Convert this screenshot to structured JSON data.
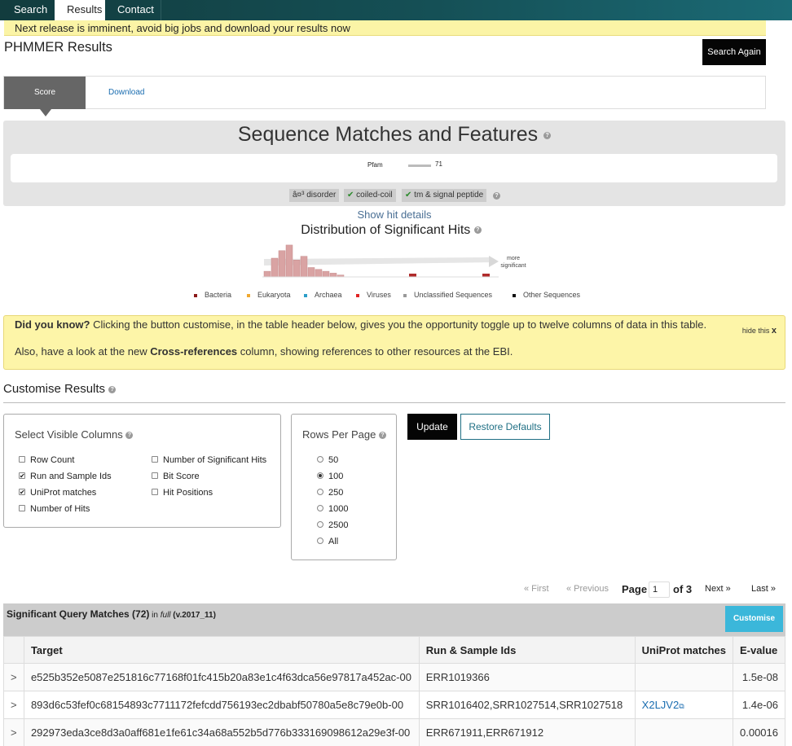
{
  "nav": {
    "tabs": [
      "Search",
      "Results",
      "Contact"
    ],
    "active": "Results"
  },
  "notice": "Next release is imminent, avoid big jobs and download your results now",
  "page_title": "PHMMER Results",
  "search_again": "Search Again",
  "result_tabs": {
    "score": "Score",
    "download": "Download"
  },
  "sequence_matches": {
    "title": "Sequence Matches and Features",
    "help": "?",
    "pfam_label": "Pfam",
    "pfam_value": "71",
    "features": [
      {
        "label": "â¤³ disorder",
        "checked": false
      },
      {
        "label": "coiled-coil",
        "checked": true
      },
      {
        "label": "tm & signal peptide",
        "checked": true
      }
    ],
    "check_glyph": "✔"
  },
  "show_hit_details": "Show hit details",
  "distribution": {
    "title": "Distribution of Significant Hits",
    "arrow_label": "more significant",
    "arrow_label_1": "more",
    "arrow_label_2": "significant"
  },
  "legend": [
    {
      "label": "Bacteria",
      "color": "#8b1a1a"
    },
    {
      "label": "Eukaryota",
      "color": "#f0a830"
    },
    {
      "label": "Archaea",
      "color": "#2c9ec8"
    },
    {
      "label": "Viruses",
      "color": "#e02424"
    },
    {
      "label": "Unclassified Sequences",
      "color": "#999999"
    },
    {
      "label": "Other Sequences",
      "color": "#111111"
    }
  ],
  "did_you_know": {
    "heading": "Did you know?",
    "line1": " Clicking the button customise, in the table header below, gives you the opportunity toggle up to twelve columns of data in this table.",
    "line2_pre": "Also, have a look at the new ",
    "line2_bold": "Cross-references",
    "line2_post": " column, showing references to other resources at the EBI.",
    "hide": "hide this",
    "hide_x": "x"
  },
  "customise": {
    "title": "Customise Results",
    "columns_title": "Select Visible Columns",
    "columns": [
      {
        "label": "Row Count",
        "checked": false
      },
      {
        "label": "Run and Sample Ids",
        "checked": true
      },
      {
        "label": "UniProt matches",
        "checked": true
      },
      {
        "label": "Number of Hits",
        "checked": false
      },
      {
        "label": "Number of Significant Hits",
        "checked": false
      },
      {
        "label": "Bit Score",
        "checked": false
      },
      {
        "label": "Hit Positions",
        "checked": false
      }
    ],
    "rows_title": "Rows Per Page",
    "rows": [
      {
        "label": "50",
        "selected": false
      },
      {
        "label": "100",
        "selected": true
      },
      {
        "label": "250",
        "selected": false
      },
      {
        "label": "1000",
        "selected": false
      },
      {
        "label": "2500",
        "selected": false
      },
      {
        "label": "All",
        "selected": false
      }
    ],
    "update": "Update",
    "restore": "Restore Defaults"
  },
  "pager": {
    "first": "« First",
    "previous": "« Previous",
    "page_label": "Page",
    "page_value": "1",
    "of": "of 3",
    "next": "Next »",
    "last": "Last »"
  },
  "table": {
    "title": "Significant Query Matches (72)",
    "in": " in ",
    "db": "full",
    "version": " (v.2017_11)",
    "customise": "Customise",
    "headers": [
      "",
      "Target",
      "Run & Sample Ids",
      "UniProt matches",
      "E-value"
    ],
    "rows": [
      {
        "expand": ">",
        "target": "e525b352e5087e251816c77168f01fc415b20a83e1c4f63dca56e97817a452ac-00",
        "runs": "ERR1019366",
        "uniprot": "",
        "evalue": "1.5e-08"
      },
      {
        "expand": ">",
        "target": "893d6c53fef0c68154893c7711172fefcdd756193ec2dbabf50780a5e8c79e0b-00",
        "runs": "SRR1016402,SRR1027514,SRR1027518",
        "uniprot": "X2LJV2",
        "evalue": "1.4e-06"
      },
      {
        "expand": ">",
        "target": "292973eda3ce8d3a0aff681e1fe61c34a68a552b5d776b333169098612a29e3f-00",
        "runs": "ERR671911,ERR671912",
        "uniprot": "",
        "evalue": "0.00016"
      }
    ]
  },
  "histogram": {
    "bins": [
      3,
      10,
      14,
      17,
      9,
      11,
      5,
      4,
      3,
      2,
      1,
      0,
      0,
      0,
      0,
      0,
      0,
      0,
      0,
      0,
      0,
      0,
      0,
      0,
      0,
      0,
      0,
      0,
      0,
      0
    ],
    "highlight": [
      0,
      0,
      0,
      0,
      0,
      0,
      0,
      0,
      0,
      0,
      0,
      0,
      0,
      0,
      0,
      0,
      0,
      0,
      0,
      0,
      1,
      0,
      0,
      0,
      0,
      0,
      0,
      0,
      0,
      0
    ],
    "highlight_end": 1
  }
}
